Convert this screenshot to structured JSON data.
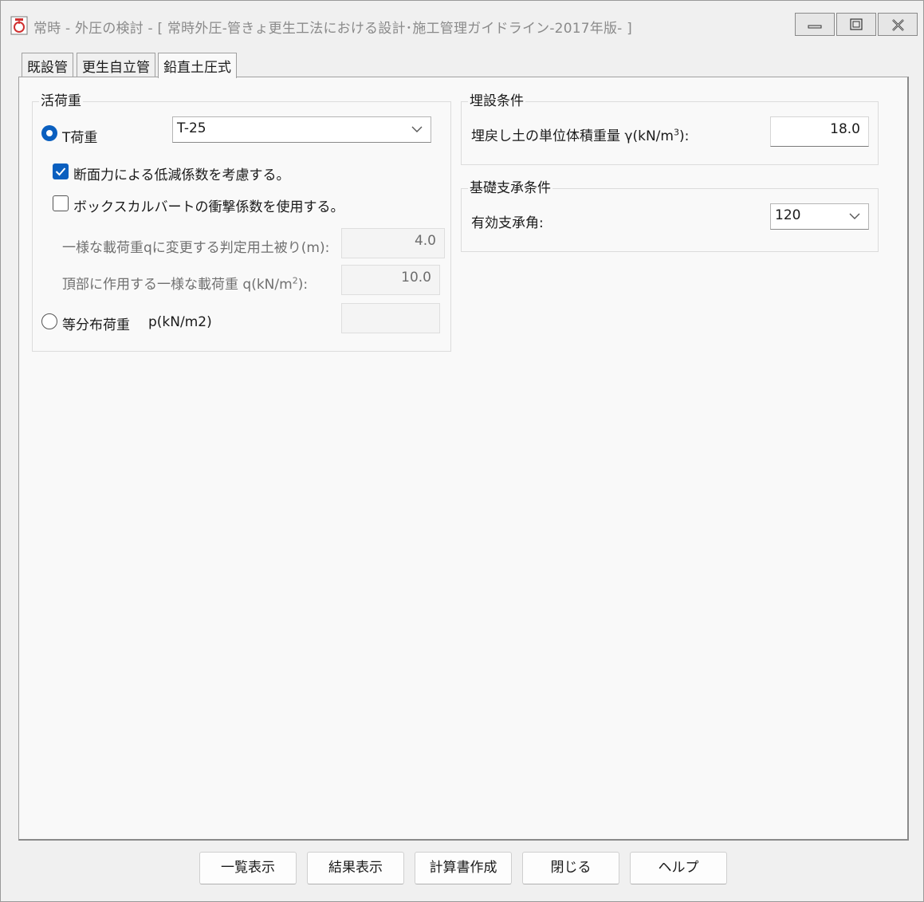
{
  "window": {
    "title": "常時 - 外圧の検討 - [ 常時外圧-管きょ更生工法における設計･施工管理ガイドライン-2017年版- ]",
    "controls": {
      "minimize": "minimize-icon",
      "restore": "restore-icon",
      "close": "close-icon"
    }
  },
  "tabs": [
    {
      "label": "既設管",
      "active": false
    },
    {
      "label": "更生自立管",
      "active": false
    },
    {
      "label": "鉛直土圧式",
      "active": true
    }
  ],
  "live_load": {
    "group_label": "活荷重",
    "t_load": {
      "label": "T荷重",
      "selected": true,
      "select_value": "T-25"
    },
    "reduction_check": {
      "label": "断面力による低減係数を考慮する。",
      "checked": true
    },
    "box_culvert_check": {
      "label": "ボックスカルバートの衝撃係数を使用する。",
      "checked": false
    },
    "cover_depth": {
      "label": "一様な載荷重qに変更する判定用土被り(m):",
      "value": "4.0"
    },
    "uniform_load": {
      "label_prefix": "頂部に作用する一様な載荷重 q(kN/m",
      "label_sup": "2",
      "label_suffix": "):",
      "value": "10.0"
    },
    "distributed_load": {
      "label": "等分布荷重",
      "unit": "p(kN/m2)",
      "selected": false,
      "value": ""
    }
  },
  "burial": {
    "group_label": "埋設条件",
    "unit_weight": {
      "label_prefix": "埋戻し土の単位体積重量 γ(kN/m",
      "label_sup": "3",
      "label_suffix": "):",
      "value": "18.0"
    }
  },
  "foundation": {
    "group_label": "基礎支承条件",
    "bearing_angle": {
      "label": "有効支承角:",
      "value": "120"
    }
  },
  "buttons": {
    "list": "一覧表示",
    "results": "結果表示",
    "report": "計算書作成",
    "close": "閉じる",
    "help": "ヘルプ"
  },
  "colors": {
    "accent": "#0a5fbf",
    "background": "#f0f0f0",
    "panel": "#f9f9f9"
  }
}
